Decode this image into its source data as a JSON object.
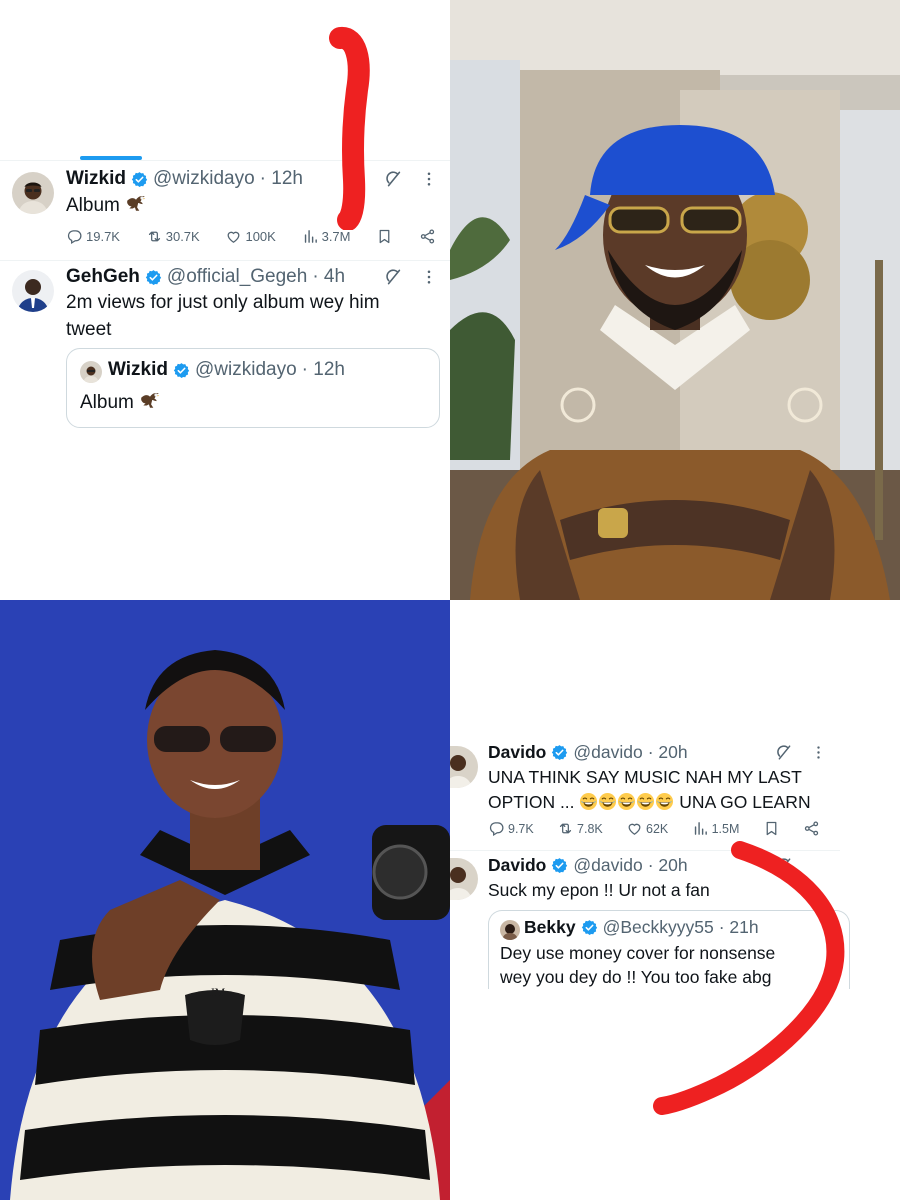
{
  "panels": {
    "top_left": {
      "tweet1": {
        "name": "Wizkid",
        "handle": "@wizkidayo",
        "time": "· 12h",
        "text": "Album",
        "stats": {
          "replies": "19.7K",
          "reposts": "30.7K",
          "likes": "100K",
          "views": "3.7M"
        }
      },
      "tweet2": {
        "name": "GehGeh",
        "handle": "@official_Gegeh",
        "time": "· 4h",
        "text": "2m views for just only album wey him tweet",
        "quote": {
          "name": "Wizkid",
          "handle": "@wizkidayo",
          "time": "· 12h",
          "text": "Album"
        }
      }
    },
    "bottom_right": {
      "tweet1": {
        "name": "Davido",
        "handle": "@davido",
        "time": "· 20h",
        "text_line1": "UNA THINK SAY MUSIC NAH MY LAST",
        "text_line2a": "OPTION ...",
        "text_line2b": "UNA GO LEARN",
        "stats": {
          "replies": "9.7K",
          "reposts": "7.8K",
          "likes": "62K",
          "views": "1.5M"
        }
      },
      "tweet2": {
        "name": "Davido",
        "handle": "@davido",
        "time": "· 20h",
        "text": "Suck my epon !! Ur not a fan",
        "quote": {
          "name": "Bekky",
          "handle": "@Beckkyyy55",
          "time": "· 21h",
          "text_line1": "Dey use money cover for nonsense",
          "text_line2": "wey you dey do !! You too fake abg"
        }
      }
    },
    "photos": {
      "top_right": "photo-man-blue-cap-brown-shirt",
      "bottom_left": "photo-man-striped-polo-sunglasses"
    }
  },
  "colors": {
    "verified": "#1d9bf0",
    "scribble": "#ee2121",
    "muted": "#536471",
    "wizkid_backdrop": "#2a41b5"
  }
}
